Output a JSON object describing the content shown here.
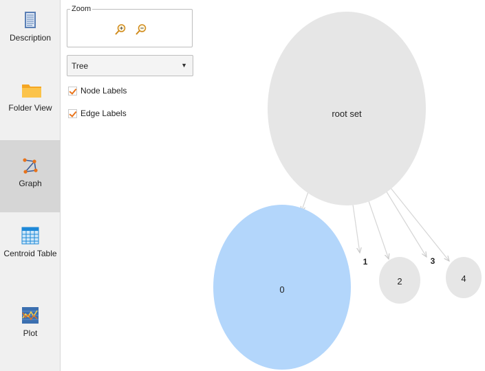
{
  "sidebar": {
    "items": [
      {
        "label": "Description",
        "icon": "document-icon",
        "active": false
      },
      {
        "label": "Folder View",
        "icon": "folder-icon",
        "active": false
      },
      {
        "label": "Graph",
        "icon": "graph-icon",
        "active": true
      },
      {
        "label": "Centroid Table",
        "icon": "table-icon",
        "active": false
      },
      {
        "label": "Plot",
        "icon": "plot-icon",
        "active": false
      }
    ]
  },
  "controls": {
    "zoom_label": "Zoom",
    "zoom_in_icon": "zoom-in-icon",
    "zoom_out_icon": "zoom-out-icon",
    "layout_select": {
      "value": "Tree"
    },
    "node_labels": {
      "label": "Node Labels",
      "checked": true
    },
    "edge_labels": {
      "label": "Edge Labels",
      "checked": true
    }
  },
  "graph": {
    "colors": {
      "node": "#e6e6e6",
      "selected_node": "#b3d6fb",
      "edge": "#d6d6d6",
      "checkmark": "#e8731a"
    },
    "nodes": [
      {
        "id": "root",
        "label": "root set",
        "selected": false
      },
      {
        "id": "0",
        "label": "0",
        "selected": true
      },
      {
        "id": "2",
        "label": "2",
        "selected": false
      },
      {
        "id": "4",
        "label": "4",
        "selected": false
      }
    ],
    "edges": [
      {
        "from": "root",
        "to": "0",
        "label": ""
      },
      {
        "from": "root",
        "to": "1",
        "label": "1"
      },
      {
        "from": "root",
        "to": "2",
        "label": ""
      },
      {
        "from": "root",
        "to": "3",
        "label": "3"
      },
      {
        "from": "root",
        "to": "4",
        "label": ""
      }
    ]
  }
}
